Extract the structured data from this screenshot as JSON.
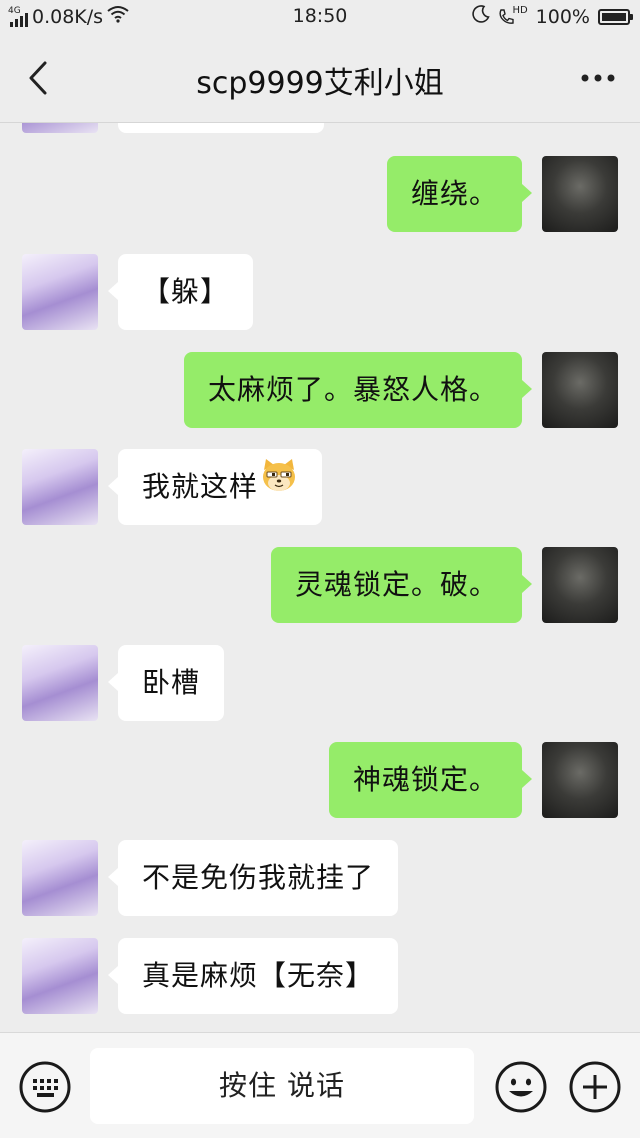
{
  "status_bar": {
    "network_label": "4G",
    "speed": "0.08K/s",
    "time": "18:50",
    "hd_label": "HD",
    "battery": "100%"
  },
  "header": {
    "title": "scp9999艾利小姐"
  },
  "messages": [
    {
      "side": "left",
      "text": "",
      "partial": true
    },
    {
      "side": "right",
      "text": "缠绕。"
    },
    {
      "side": "left",
      "text": "【躲】"
    },
    {
      "side": "right",
      "text": "太麻烦了。暴怒人格。"
    },
    {
      "side": "left",
      "text": "我就这样",
      "emoji": "dog-face-emoji"
    },
    {
      "side": "right",
      "text": "灵魂锁定。破。"
    },
    {
      "side": "left",
      "text": "卧槽"
    },
    {
      "side": "right",
      "text": "神魂锁定。"
    },
    {
      "side": "left",
      "text": "不是免伤我就挂了"
    },
    {
      "side": "left",
      "text": "真是麻烦【无奈】"
    }
  ],
  "input_bar": {
    "hold_to_talk": "按住 说话"
  },
  "colors": {
    "background": "#ededed",
    "bubble_self": "#95ec69",
    "bubble_other": "#ffffff"
  },
  "icons": [
    "back-arrow-icon",
    "more-icon",
    "keyboard-icon",
    "emoji-icon",
    "plus-icon",
    "wifi-icon",
    "moon-icon",
    "hd-call-icon",
    "battery-icon"
  ]
}
